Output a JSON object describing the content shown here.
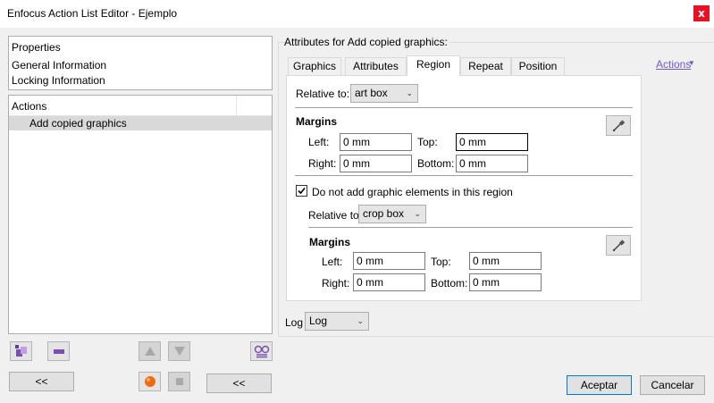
{
  "window": {
    "title": "Enfocus Action List Editor - Ejemplo",
    "close": "x"
  },
  "properties_panel": {
    "header": "Properties",
    "items": [
      "General Information",
      "Locking Information"
    ]
  },
  "actions_panel": {
    "header": "Actions",
    "items": [
      "Add copied graphics"
    ]
  },
  "left_buttons": {
    "collapse_left": "<<",
    "collapse_mid": "<<"
  },
  "group": {
    "label": "Attributes for Add copied graphics:"
  },
  "tabs": [
    "Graphics",
    "Attributes",
    "Region",
    "Repeat",
    "Position"
  ],
  "active_tab": "Region",
  "actions_link": "Actions",
  "region": {
    "relative_label": "Relative to:",
    "relative_value": "art box",
    "margins_title": "Margins",
    "left_label": "Left:",
    "left_value": "0 mm",
    "top_label": "Top:",
    "top_value": "0 mm",
    "right_label": "Right:",
    "right_value": "0 mm",
    "bottom_label": "Bottom:",
    "bottom_value": "0 mm",
    "exclude_checkbox_label": "Do not add graphic elements in this region",
    "exclude_checked": true,
    "exclude_relative_label": "Relative to:",
    "exclude_relative_value": "crop box",
    "exclude_margins_title": "Margins",
    "exclude_left_label": "Left:",
    "exclude_left_value": "0 mm",
    "exclude_top_label": "Top:",
    "exclude_top_value": "0 mm",
    "exclude_right_label": "Right:",
    "exclude_right_value": "0 mm",
    "exclude_bottom_label": "Bottom:",
    "exclude_bottom_value": "0 mm"
  },
  "log": {
    "label": "Log",
    "value": "Log"
  },
  "footer": {
    "ok": "Aceptar",
    "cancel": "Cancelar"
  },
  "colors": {
    "close": "#e81123",
    "link": "#6c5bd3",
    "selection": "#d9d9d9",
    "focus_border": "#000000"
  }
}
